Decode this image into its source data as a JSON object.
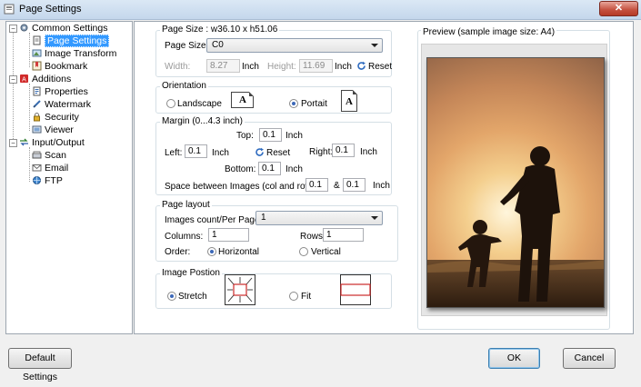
{
  "window": {
    "title": "Page Settings",
    "close_glyph": "✕"
  },
  "tree": {
    "items": [
      {
        "label": "Common Settings",
        "icon": "gear-icon"
      },
      {
        "label": "Page Settings",
        "icon": "page-icon",
        "selected": true
      },
      {
        "label": "Image Transform",
        "icon": "image-icon"
      },
      {
        "label": "Bookmark",
        "icon": "bookmark-icon"
      },
      {
        "label": "Additions",
        "icon": "pdf-icon"
      },
      {
        "label": "Properties",
        "icon": "properties-icon"
      },
      {
        "label": "Watermark",
        "icon": "watermark-icon"
      },
      {
        "label": "Security",
        "icon": "lock-icon"
      },
      {
        "label": "Viewer",
        "icon": "viewer-icon"
      },
      {
        "label": "Input/Output",
        "icon": "io-icon"
      },
      {
        "label": "Scan",
        "icon": "scanner-icon"
      },
      {
        "label": "Email",
        "icon": "email-icon"
      },
      {
        "label": "FTP",
        "icon": "ftp-icon"
      }
    ],
    "expander_glyph": "−"
  },
  "page_size": {
    "group_title": "Page Size : w36.10 x h51.06",
    "size_label": "Page Size:",
    "size_value": "C0",
    "width_label": "Width:",
    "width_value": "8.27",
    "height_label": "Height:",
    "height_value": "11.69",
    "unit": "Inch",
    "reset_label": "Reset"
  },
  "orientation": {
    "group_title": "Orientation",
    "landscape_label": "Landscape",
    "portrait_label": "Portait",
    "icon_glyph": "A",
    "selected": "portrait"
  },
  "margin": {
    "group_title": "Margin (0...4.3 inch)",
    "top_label": "Top:",
    "top_value": "0.1",
    "left_label": "Left:",
    "left_value": "0.1",
    "right_label": "Right:",
    "right_value": "0.1",
    "bottom_label": "Bottom:",
    "bottom_value": "0.1",
    "unit": "Inch",
    "reset_label": "Reset",
    "spacing_label": "Space between Images (col and row) :",
    "spacing_col_value": "0.1",
    "spacing_and": "&",
    "spacing_row_value": "0.1"
  },
  "page_layout": {
    "group_title": "Page layout",
    "count_label": "Images count/Per Page",
    "count_value": "1",
    "columns_label": "Columns:",
    "columns_value": "1",
    "rows_label": "Rows:",
    "rows_value": "1",
    "order_label": "Order:",
    "horizontal_label": "Horizontal",
    "vertical_label": "Vertical",
    "selected": "horizontal"
  },
  "image_position": {
    "group_title": "Image Postion",
    "stretch_label": "Stretch",
    "fit_label": "Fit",
    "selected": "stretch"
  },
  "preview": {
    "title": "Preview (sample image size: A4)"
  },
  "buttons": {
    "default_settings": "Default Settings",
    "ok": "OK",
    "cancel": "Cancel"
  },
  "colors": {
    "selection": "#3399ff",
    "accent_red": "#cc2a2a",
    "title_bar": "#c4d7ec"
  }
}
